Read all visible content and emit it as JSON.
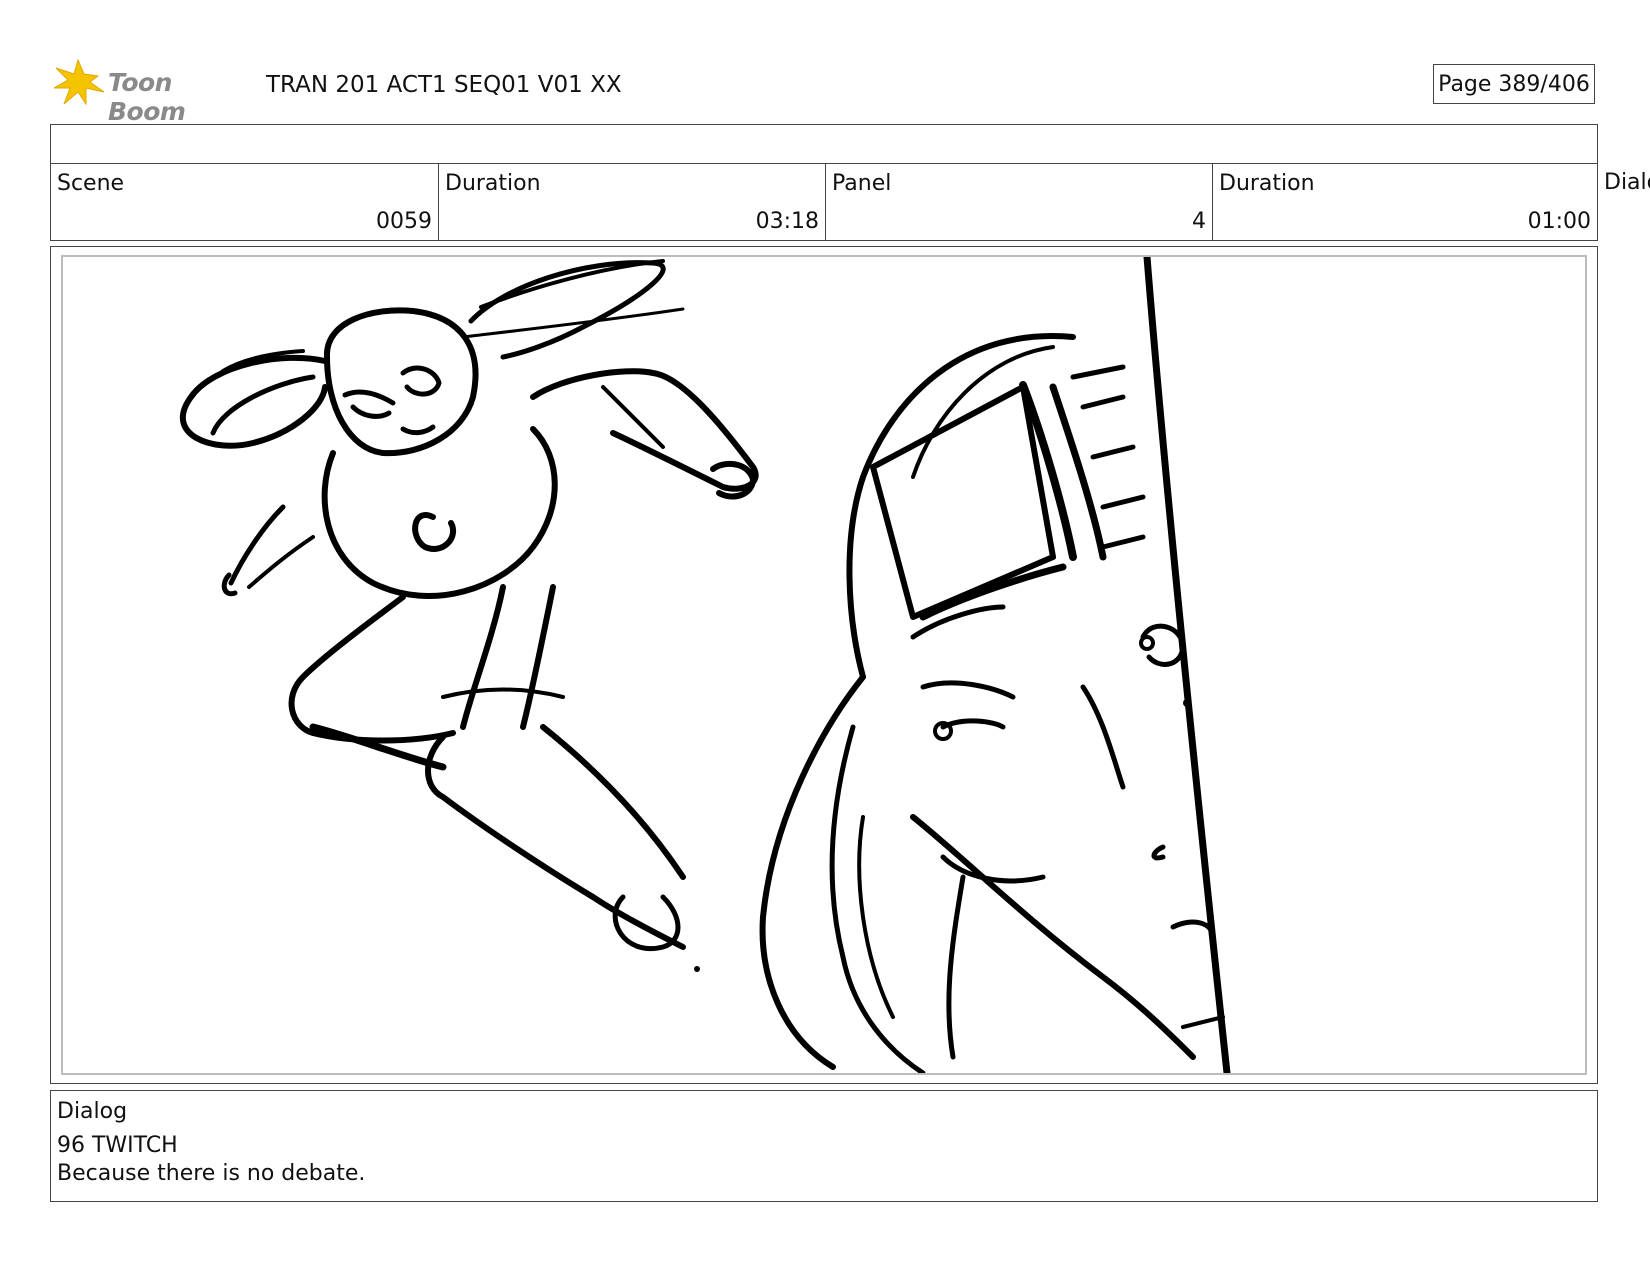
{
  "header": {
    "logo_text": "Toon Boom",
    "title": "TRAN 201 ACT1 SEQ01 V01 XX",
    "page": "Page 389/406"
  },
  "info": {
    "scene_label": "Scene",
    "scene_value": "0059",
    "scene_duration_label": "Duration",
    "scene_duration_value": "03:18",
    "panel_label": "Panel",
    "panel_value": "4",
    "panel_duration_label": "Duration",
    "panel_duration_value": "01:00",
    "overflow_label": "Dialo"
  },
  "dialog": {
    "label": "Dialog",
    "line1": "96 TWITCH",
    "line2": "Because there is no debate."
  },
  "colors": {
    "logo_star": "#f5c400",
    "logo_text": "#8a8a8a",
    "border": "#444444",
    "panel_inner_border": "#bcbcbc",
    "ink": "#000000"
  }
}
